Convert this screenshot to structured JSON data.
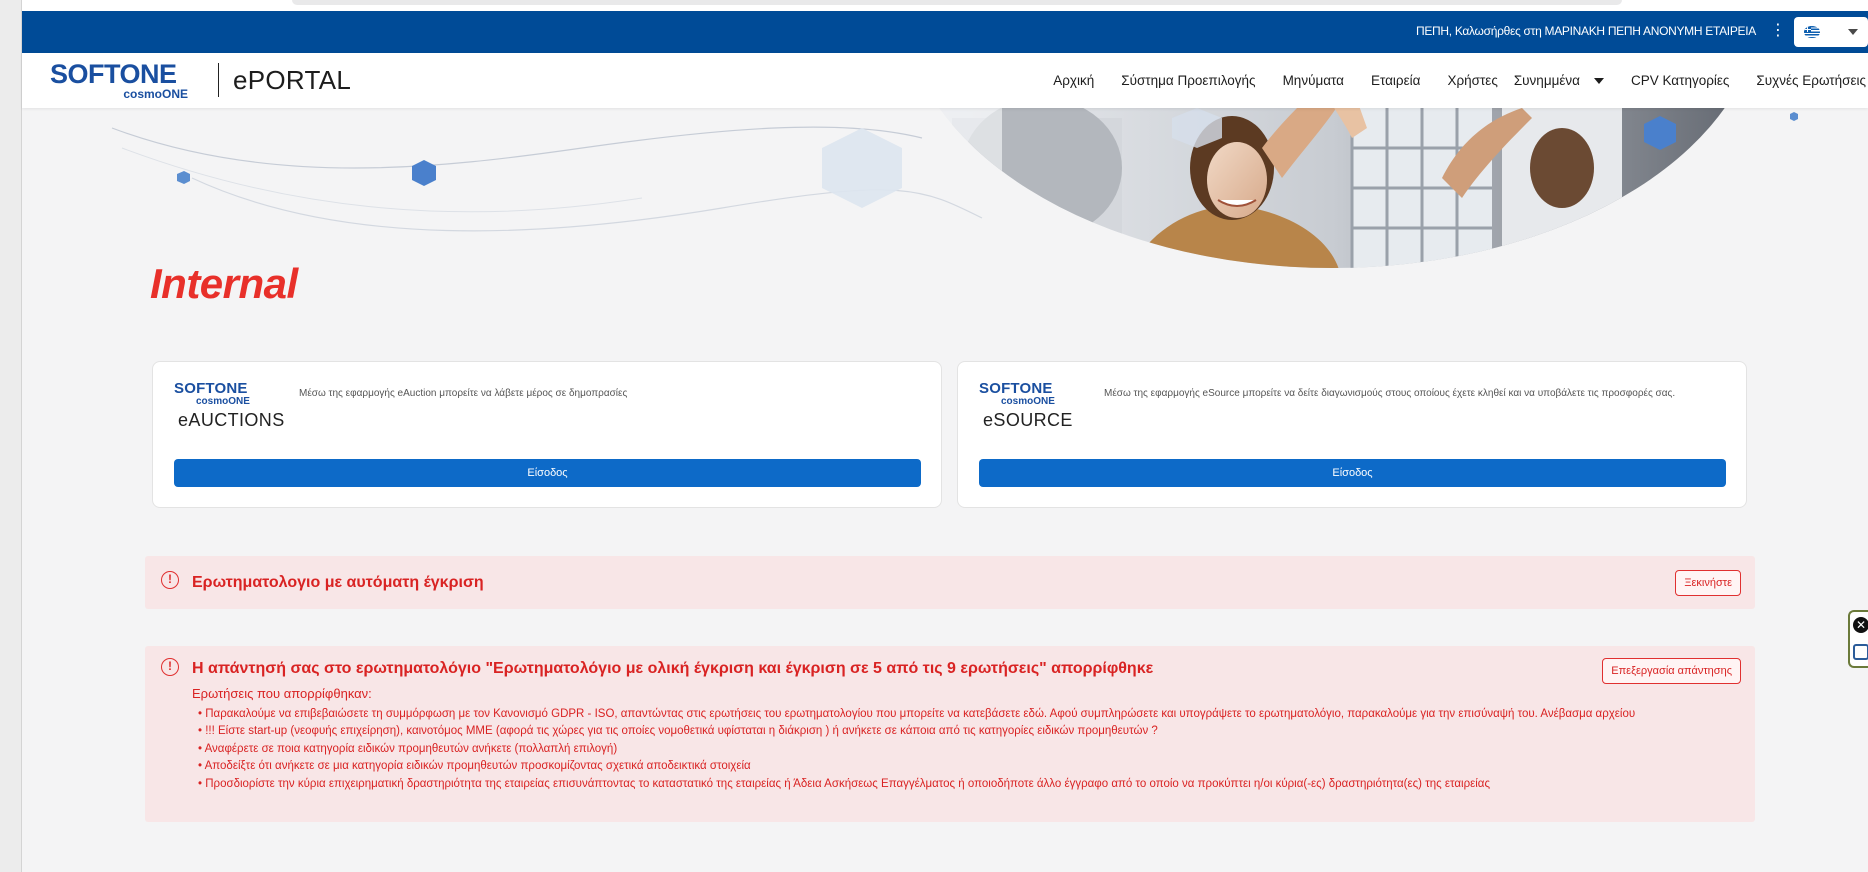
{
  "header": {
    "greeting": "ΠΕΠΗ, Καλωσήρθες στη ΜΑΡΙΝΑΚΗ ΠΕΠΗ ΑΝΟΝΥΜΗ ΕΤΑΙΡΕΙΑ",
    "menu_icon": "kebab-menu-icon",
    "language_flag": "greek-flag-icon"
  },
  "brand": {
    "logo_word": "SOFTONE",
    "logo_sub": "cosmoONE",
    "portal_name": "ePORTAL"
  },
  "nav": {
    "items": [
      "Αρχική",
      "Σύστημα Προεπιλογής",
      "Μηνύματα",
      "Εταιρεία",
      "Χρήστες",
      "Συνημμένα",
      "CPV Κατηγορίες",
      "Συχνές Ερωτήσεις"
    ]
  },
  "page": {
    "heading": "Internal"
  },
  "cards": [
    {
      "logo_word": "SOFTONE",
      "logo_sub": "cosmoONE",
      "product": "eAUCTIONS",
      "description": "Μέσω της εφαρμογής eAuction μπορείτε να λάβετε μέρος σε δημοπρασίες",
      "button": "Είσοδος"
    },
    {
      "logo_word": "SOFTONE",
      "logo_sub": "cosmoONE",
      "product": "eSOURCE",
      "description": "Μέσω της εφαρμογής eSource μπορείτε να δείτε διαγωνισμούς στους οποίους έχετε κληθεί και να υποβάλετε τις προσφορές σας.",
      "button": "Είσοδος"
    }
  ],
  "alerts": [
    {
      "icon": "!",
      "title": "Ερωτηματολογιο με αυτόματη έγκριση",
      "button": "Ξεκινήστε"
    },
    {
      "icon": "!",
      "title": "Η απάντησή σας στο ερωτηματολόγιο \"Ερωτηματολόγιο με ολική έγκριση και έγκριση σε 5 από τις 9 ερωτήσεις\" απορρίφθηκε",
      "button": "Επεξεργασία απάντησης",
      "subtitle": "Ερωτήσεις που απορρίφθηκαν:",
      "items": [
        "Παρακαλούμε να επιβεβαιώσετε τη συμμόρφωση με τον Κανονισμό GDPR - ISO, απαντώντας στις ερωτήσεις του ερωτηματολογίου που μπορείτε να κατεβάσετε εδώ. Αφού συμπληρώσετε και υπογράψετε το ερωτηματολόγιο, παρακαλούμε για την επισύναψή του. Ανέβασμα αρχείου",
        "!!! Είστε start-up (νεοφυής επιχείρηση), καινοτόμος ΜΜΕ (αφορά τις χώρες για τις οποίες νομοθετικά υφίσταται η διάκριση ) ή ανήκετε σε κάποια από τις κατηγορίες ειδικών προμηθευτών ?",
        "Αναφέρετε σε ποια κατηγορία ειδικών προμηθευτών ανήκετε (πολλαπλή επιλογή)",
        "Αποδείξτε ότι ανήκετε σε μια κατηγορία ειδικών προμηθευτών προσκομίζοντας σχετικά αποδεικτικά στοιχεία",
        "Προσδιορίστε την κύρια επιχειρηματική δραστηριότητα της εταιρείας επισυνάπτοντας το καταστατικό της εταιρείας ή Άδεια Ασκήσεως Επαγγέλματος ή οποιοδήποτε άλλο έγγραφο από το οποίο να προκύπτει η/οι κύρια(-ες) δραστηριότητα(ες) της εταιρείας"
      ]
    }
  ],
  "colors": {
    "topbar": "#004b97",
    "brand_blue": "#1a4fa0",
    "button_blue": "#0d6ac8",
    "alert_red": "#d92323",
    "alert_bg": "#f8e6e7",
    "heading_red": "#e8302a"
  }
}
